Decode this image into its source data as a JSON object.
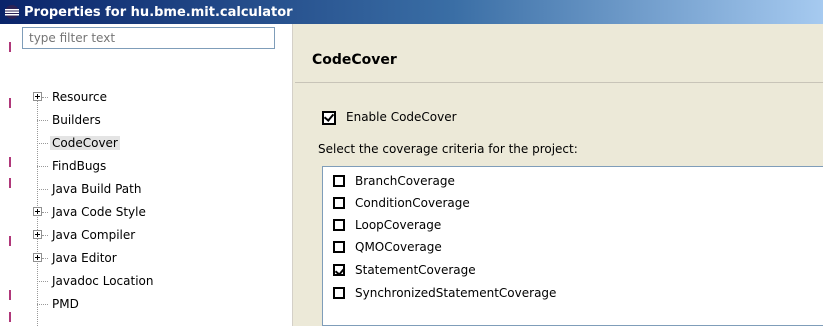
{
  "window": {
    "title": "Properties for hu.bme.mit.calculator",
    "icon": "eclipse-icon"
  },
  "filter": {
    "placeholder": "type filter text"
  },
  "tree": {
    "items": [
      {
        "label": "Resource",
        "expandable": true,
        "selected": false
      },
      {
        "label": "Builders",
        "expandable": false,
        "selected": false
      },
      {
        "label": "CodeCover",
        "expandable": false,
        "selected": true
      },
      {
        "label": "FindBugs",
        "expandable": false,
        "selected": false
      },
      {
        "label": "Java Build Path",
        "expandable": false,
        "selected": false
      },
      {
        "label": "Java Code Style",
        "expandable": true,
        "selected": false
      },
      {
        "label": "Java Compiler",
        "expandable": true,
        "selected": false
      },
      {
        "label": "Java Editor",
        "expandable": true,
        "selected": false
      },
      {
        "label": "Javadoc Location",
        "expandable": false,
        "selected": false
      },
      {
        "label": "PMD",
        "expandable": false,
        "selected": false
      }
    ]
  },
  "page": {
    "title": "CodeCover",
    "enable_label": "Enable CodeCover",
    "enable_checked": true,
    "criteria_prompt": "Select the coverage criteria for the project:",
    "criteria": [
      {
        "label": "BranchCoverage",
        "checked": false
      },
      {
        "label": "ConditionCoverage",
        "checked": false
      },
      {
        "label": "LoopCoverage",
        "checked": false
      },
      {
        "label": "QMOCoverage",
        "checked": false
      },
      {
        "label": "StatementCoverage",
        "checked": true
      },
      {
        "label": "SynchronizedStatementCoverage",
        "checked": false
      }
    ]
  },
  "colors": {
    "title_bar": "#0a246a",
    "dialog_background": "#ece9d8",
    "selection": "#e4e4e4"
  }
}
